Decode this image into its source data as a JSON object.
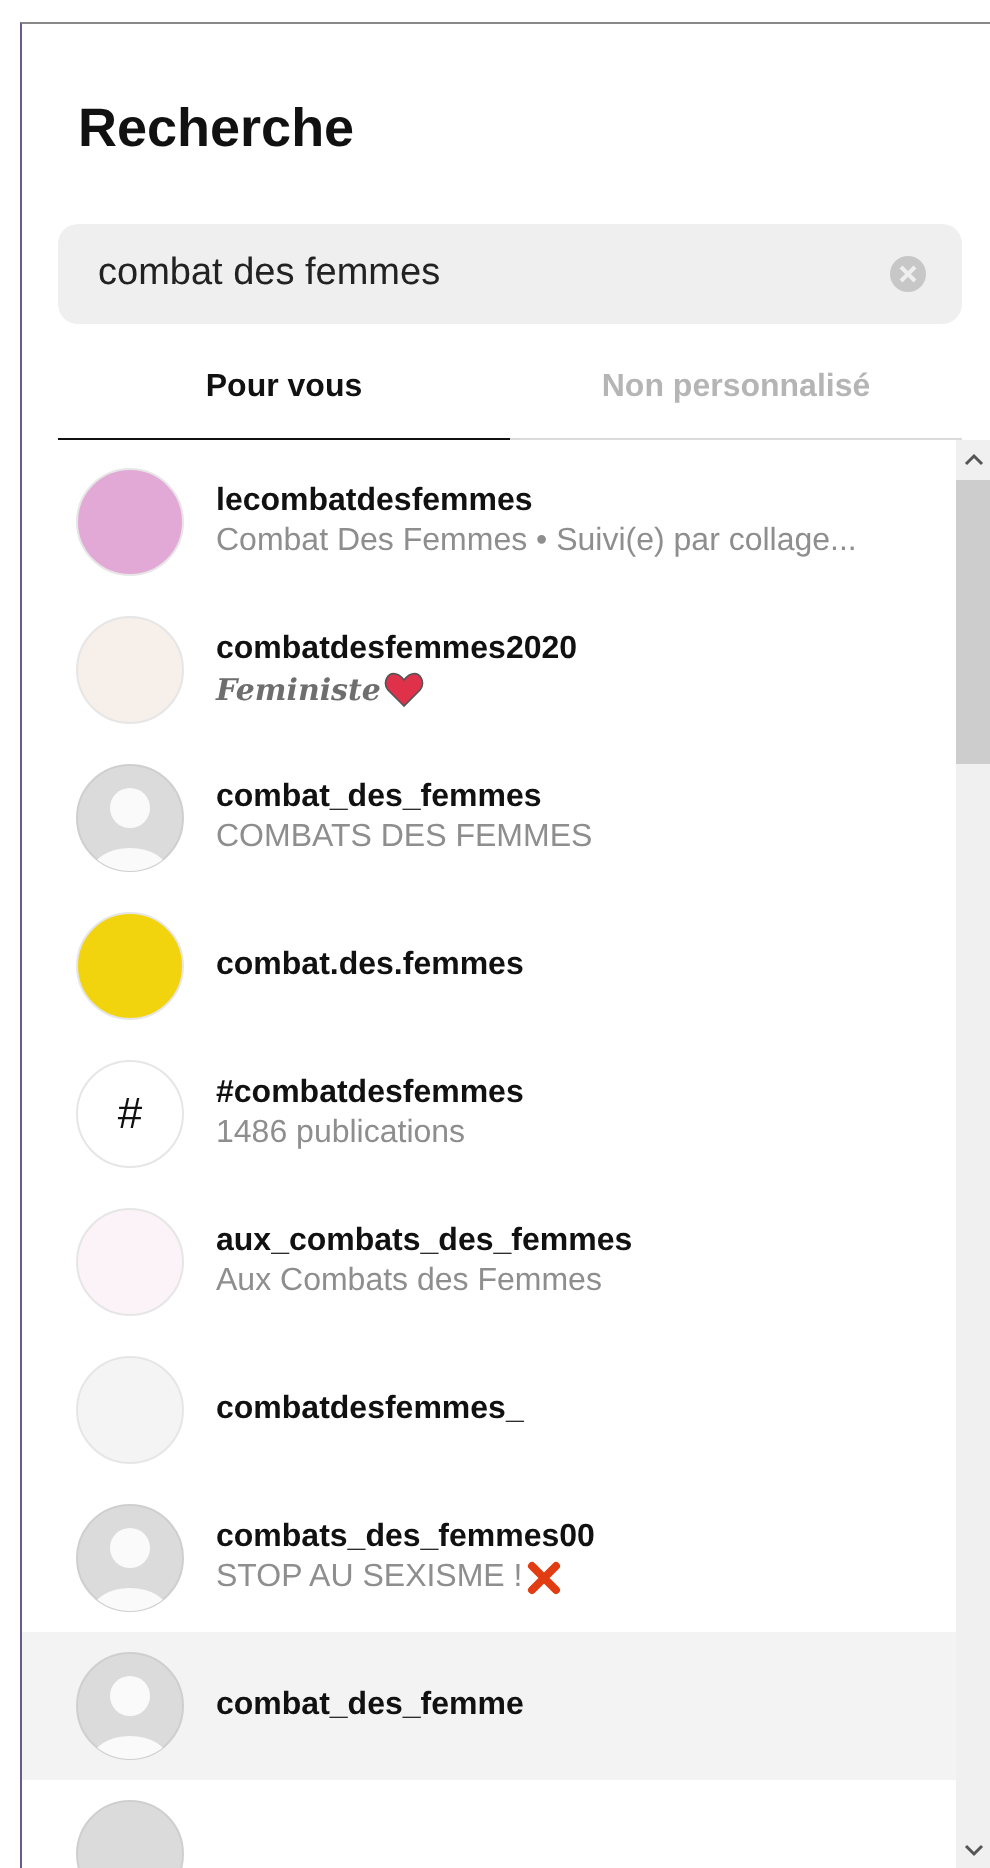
{
  "title": "Recherche",
  "search": {
    "value": "combat des femmes"
  },
  "tabs": [
    {
      "label": "Pour vous",
      "selected": true
    },
    {
      "label": "Non personnalisé",
      "selected": false
    }
  ],
  "results": [
    {
      "name": "lecombatdesfemmes",
      "subtitle": "Combat Des Femmes • Suivi(e) par collage...",
      "kind": "photo",
      "color": "#e3a9d6",
      "hover": false
    },
    {
      "name": "combatdesfemmes2020",
      "subtitle": "**Feministe**",
      "emoji": {
        "kind": "heart"
      },
      "kind": "logo",
      "color": "#f6efea",
      "hover": false
    },
    {
      "name": "combat_des_femmes",
      "subtitle": "COMBATS DES FEMMES",
      "kind": "default",
      "hover": false
    },
    {
      "name": "combat.des.femmes",
      "kind": "photo",
      "color": "#f2d40e",
      "hover": false
    },
    {
      "name": "#combatdesfemmes",
      "subtitle": "1486 publications",
      "kind": "hashtag",
      "symbol": "#",
      "hover": false
    },
    {
      "name": "aux_combats_des_femmes",
      "subtitle": "Aux Combats des Femmes",
      "kind": "logo",
      "color": "#fbf3f7",
      "hover": false
    },
    {
      "name": "combatdesfemmes_",
      "kind": "logo",
      "color": "#f4f4f4",
      "hover": false
    },
    {
      "name": "combats_des_femmes00",
      "subtitle": "STOP AU SEXISME !",
      "emoji": {
        "kind": "cross"
      },
      "kind": "default",
      "hover": false
    },
    {
      "name": "combat_des_femme",
      "kind": "default",
      "hover": true
    }
  ]
}
